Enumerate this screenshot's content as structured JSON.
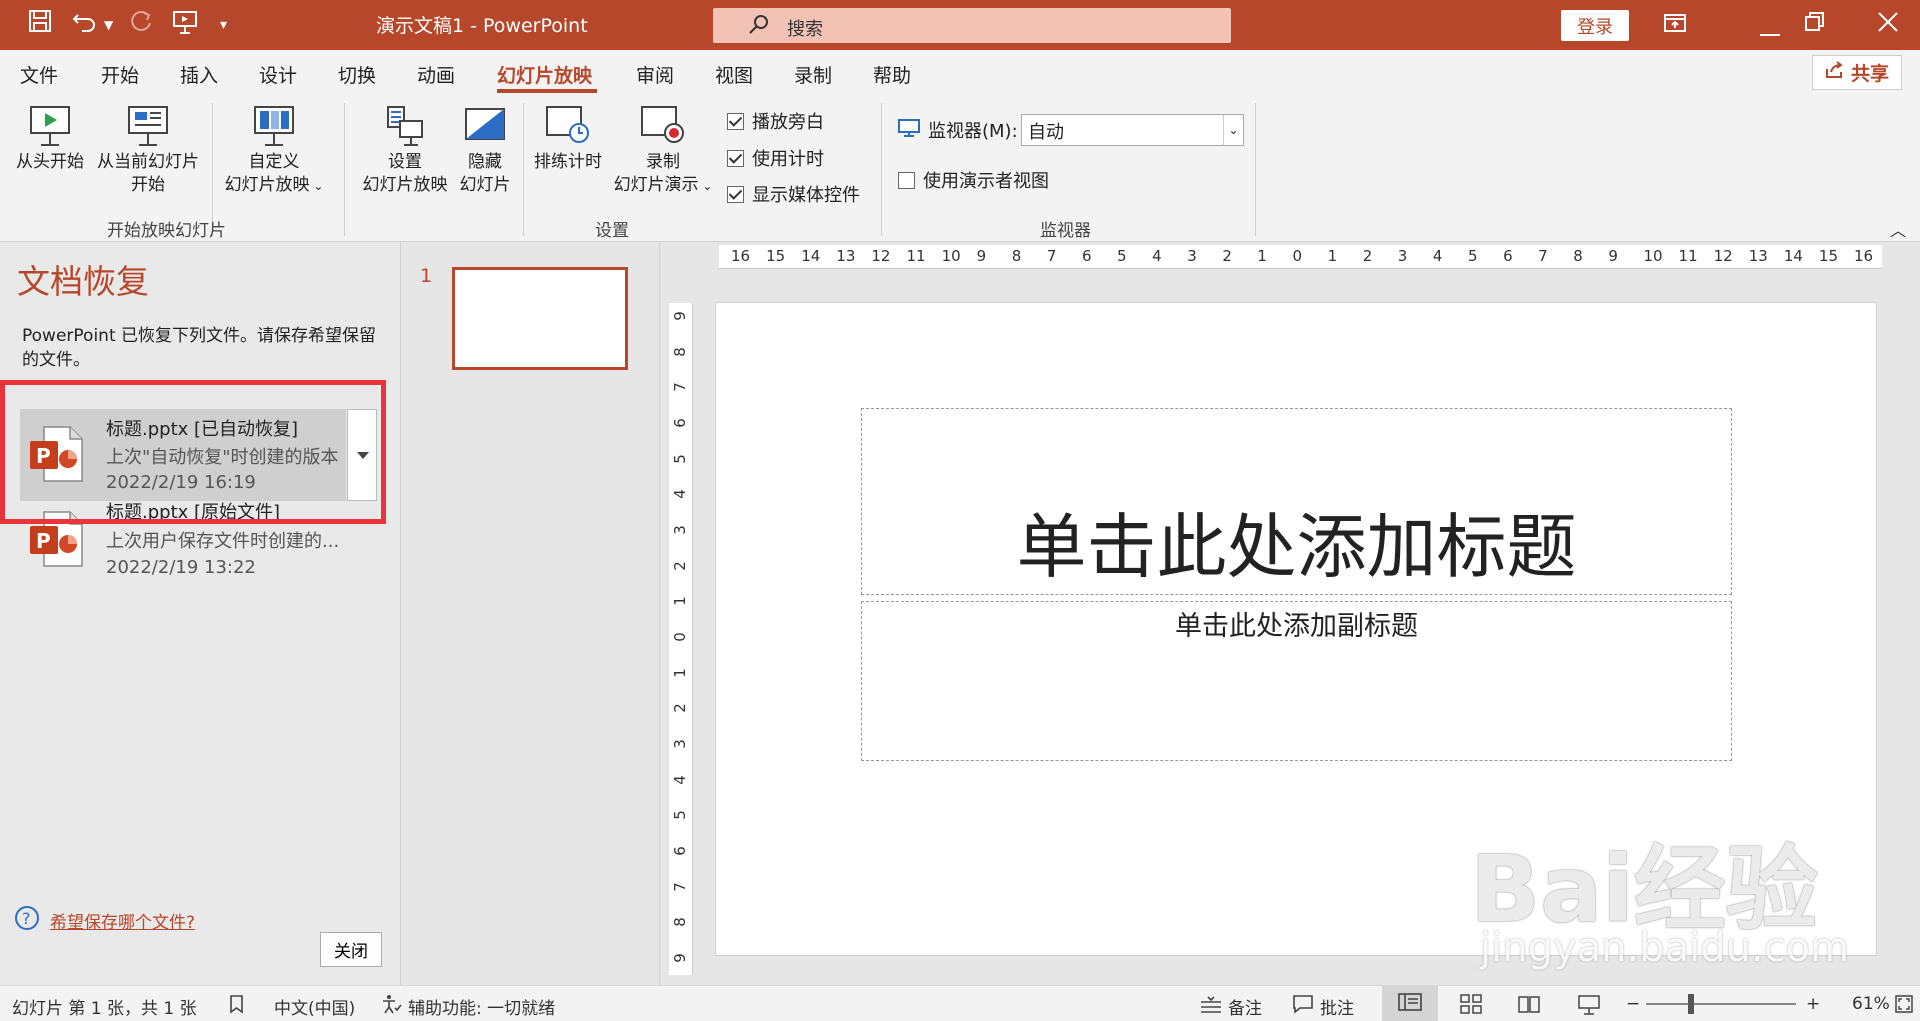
{
  "titlebar": {
    "doc_title": "演示文稿1  -  PowerPoint",
    "search_placeholder": "搜索",
    "login_label": "登录"
  },
  "tabs": [
    {
      "label": "文件"
    },
    {
      "label": "开始"
    },
    {
      "label": "插入"
    },
    {
      "label": "设计"
    },
    {
      "label": "切换"
    },
    {
      "label": "动画"
    },
    {
      "label": "幻灯片放映",
      "active": true
    },
    {
      "label": "审阅"
    },
    {
      "label": "视图"
    },
    {
      "label": "录制"
    },
    {
      "label": "帮助"
    }
  ],
  "share_label": "共享",
  "ribbon": {
    "from_start": "从头开始",
    "from_current_1": "从当前幻灯片",
    "from_current_2": "开始",
    "custom_1": "自定义",
    "custom_2": "幻灯片放映",
    "group_start": "开始放映幻灯片",
    "setup_1": "设置",
    "setup_2": "幻灯片放映",
    "hide_1": "隐藏",
    "hide_2": "幻灯片",
    "rehearse": "排练计时",
    "record_1": "录制",
    "record_2": "幻灯片演示",
    "chk_narration": "播放旁白",
    "chk_timing": "使用计时",
    "chk_media": "显示媒体控件",
    "group_setup": "设置",
    "monitor_label": "监视器(M):",
    "monitor_value": "自动",
    "chk_presenter": "使用演示者视图",
    "group_monitor": "监视器"
  },
  "recovery": {
    "title": "文档恢复",
    "description": "PowerPoint 已恢复下列文件。请保存希望保留的文件。",
    "items": [
      {
        "name": "标题.pptx  [已自动恢复]",
        "sub": "上次\"自动恢复\"时创建的版本",
        "time": "2022/2/19 16:19"
      },
      {
        "name": "标题.pptx  [原始文件]",
        "sub": "上次用户保存文件时创建的...",
        "time": "2022/2/19 13:22"
      }
    ],
    "help_link": "希望保存哪个文件?",
    "close_label": "关闭"
  },
  "thumbnail": {
    "number": "1"
  },
  "slide": {
    "title_placeholder": "单击此处添加标题",
    "subtitle_placeholder": "单击此处添加副标题"
  },
  "ruler": {
    "h_ticks": [
      "16",
      "15",
      "14",
      "13",
      "12",
      "11",
      "10",
      "9",
      "8",
      "7",
      "6",
      "5",
      "4",
      "3",
      "2",
      "1",
      "0",
      "1",
      "2",
      "3",
      "4",
      "5",
      "6",
      "7",
      "8",
      "9",
      "10",
      "11",
      "12",
      "13",
      "14",
      "15",
      "16"
    ],
    "v_ticks": [
      "9",
      "8",
      "7",
      "6",
      "5",
      "4",
      "3",
      "2",
      "1",
      "0",
      "1",
      "2",
      "3",
      "4",
      "5",
      "6",
      "7",
      "8",
      "9"
    ]
  },
  "statusbar": {
    "slide_info": "幻灯片 第 1 张，共 1 张",
    "language": "中文(中国)",
    "accessibility": "辅助功能: 一切就绪",
    "notes": "备注",
    "comments": "批注",
    "zoom": "61%"
  },
  "watermark": {
    "main": "Bai经验",
    "sub": "jingyan.baidu.com"
  },
  "colors": {
    "accent": "#b7472a",
    "highlight": "#e8343a"
  }
}
